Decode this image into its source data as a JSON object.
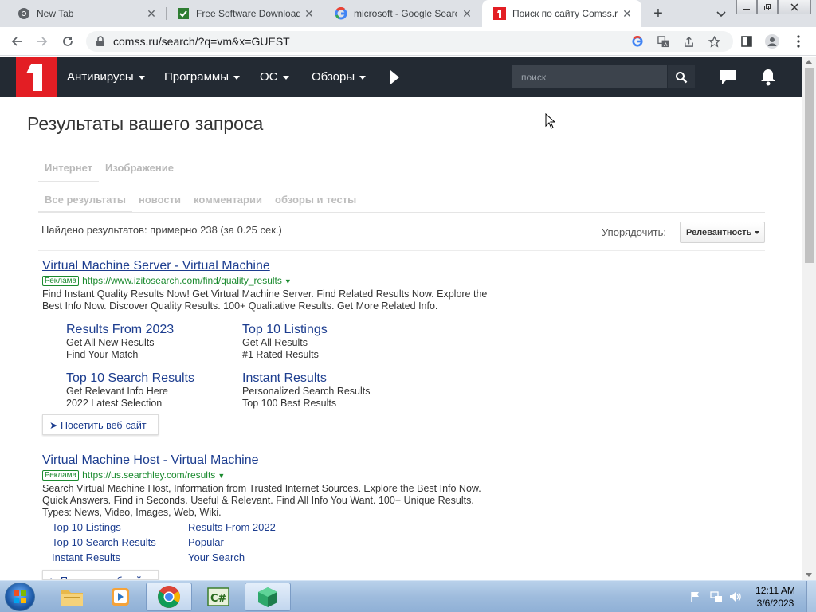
{
  "browser": {
    "tabs": [
      {
        "title": "New Tab",
        "icon": "chrome-icon"
      },
      {
        "title": "Free Software Downloads",
        "icon": "download-site-icon"
      },
      {
        "title": "microsoft - Google Search",
        "icon": "google-icon"
      },
      {
        "title": "Поиск по сайту Comss.ru",
        "icon": "comss-icon",
        "active": true
      }
    ],
    "new_tab_label": "+",
    "url": "comss.ru/search/?q=vm&x=GUEST"
  },
  "site": {
    "logo_text": "1",
    "menu": [
      {
        "label": "Антивирусы"
      },
      {
        "label": "Программы"
      },
      {
        "label": "ОС"
      },
      {
        "label": "Обзоры"
      }
    ],
    "search_placeholder": "поиск"
  },
  "content": {
    "page_title": "Результаты вашего запроса",
    "source_tabs": [
      "Интернет",
      "Изображение"
    ],
    "filter_tabs": [
      "Все результаты",
      "новости",
      "комментарии",
      "обзоры и тесты"
    ],
    "found_text": "Найдено результатов: примерно 238 (за 0.25 сек.)",
    "sort_label": "Упорядочить:",
    "sort_value": "Релевантность",
    "ad_badge": "Реклама",
    "visit_label": "Посетить веб-сайт",
    "ads": [
      {
        "title": "Virtual Machine Server - Virtual Machine",
        "url": "https://www.izitosearch.com/find/quality_results",
        "desc_lines": [
          "Find Instant Quality Results Now! Get Virtual Machine Server. Find Related Results Now. Explore the",
          "Best Info Now. Discover Quality Results. 100+ Qualitative Results. Get More Related Info."
        ],
        "sitelinks": [
          {
            "title": "Results From 2023",
            "lines": [
              "Get All New Results",
              "Find Your Match"
            ]
          },
          {
            "title": "Top 10 Listings",
            "lines": [
              "Get All Results",
              "#1 Rated Results"
            ]
          },
          {
            "title": "Top 10 Search Results",
            "lines": [
              "Get Relevant Info Here",
              "2022 Latest Selection"
            ]
          },
          {
            "title": "Instant Results",
            "lines": [
              "Personalized Search Results",
              "Top 100 Best Results"
            ]
          }
        ]
      },
      {
        "title": "Virtual Machine Host - Virtual Machine",
        "url": "https://us.searchley.com/results",
        "desc_lines": [
          "Search Virtual Machine Host, Information from Trusted Internet Sources. Explore the Best Info Now.",
          "Quick Answers. Find in Seconds. Useful & Relevant. Find All Info You Want. 100+ Unique Results.",
          "Types: News, Video, Images, Web, Wiki."
        ],
        "sitelinks": [
          "Top 10 Listings",
          "Results From 2022",
          "Top 10 Search Results",
          "Popular",
          "Instant Results",
          "Your Search"
        ]
      }
    ]
  },
  "taskbar": {
    "apps": [
      "explorer-icon",
      "media-player-icon",
      "chrome-icon",
      "csharp-icon",
      "package-icon"
    ],
    "time": "12:11 AM",
    "date": "3/6/2023"
  },
  "colors": {
    "site_header": "#232a33",
    "brand_red": "#e31e24",
    "link": "#1c3d8f",
    "ad_green": "#1a8a2e"
  }
}
